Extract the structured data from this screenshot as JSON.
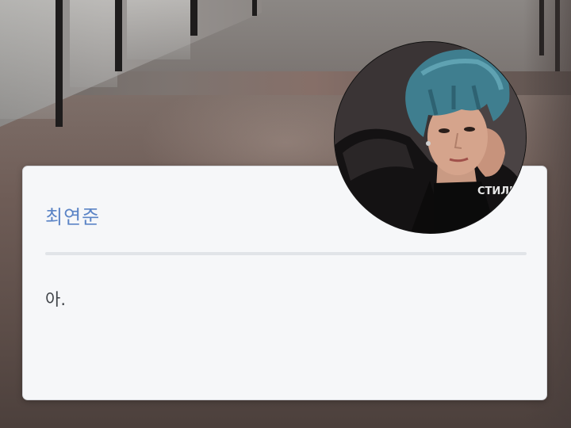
{
  "background": {
    "description_icon": "office-corridor-photo"
  },
  "card": {
    "name": "최연준",
    "message": "아."
  },
  "avatar": {
    "icon": "profile-photo-person-blue-hair",
    "shirt_text": "СТИЛЬ"
  },
  "colors": {
    "name": "#5b84c6",
    "card_bg": "#f6f7f9",
    "divider": "#e1e4e8",
    "message": "#3f4348"
  }
}
